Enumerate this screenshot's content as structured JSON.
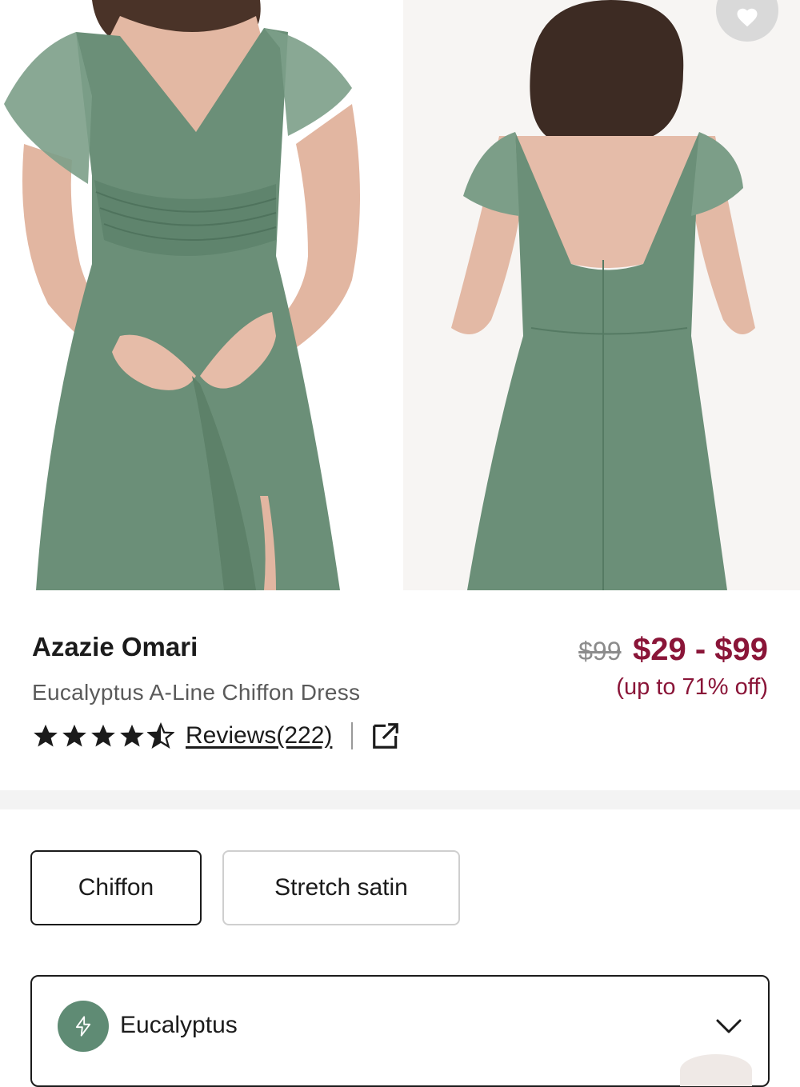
{
  "product": {
    "brand": "Azazie Omari",
    "name": "Eucalyptus A-Line Chiffon Dress",
    "rating": 4.5,
    "rating_max": 5,
    "reviews_label": "Reviews(222)"
  },
  "pricing": {
    "original": "$99",
    "range": "$29 - $99",
    "discount": "(up to 71% off)"
  },
  "fabric_options": [
    {
      "label": "Chiffon",
      "selected": true
    },
    {
      "label": "Stretch satin",
      "selected": false
    }
  ],
  "color_select": {
    "value": "Eucalyptus"
  },
  "icons": {
    "favorite": "heart-icon",
    "share": "external-link-icon",
    "swatch": "lightning-icon",
    "dropdown": "chevron-down-icon"
  },
  "colors": {
    "dress": "#6b8f78",
    "price_accent": "#8a1538",
    "swatch": "#5f8b74"
  }
}
